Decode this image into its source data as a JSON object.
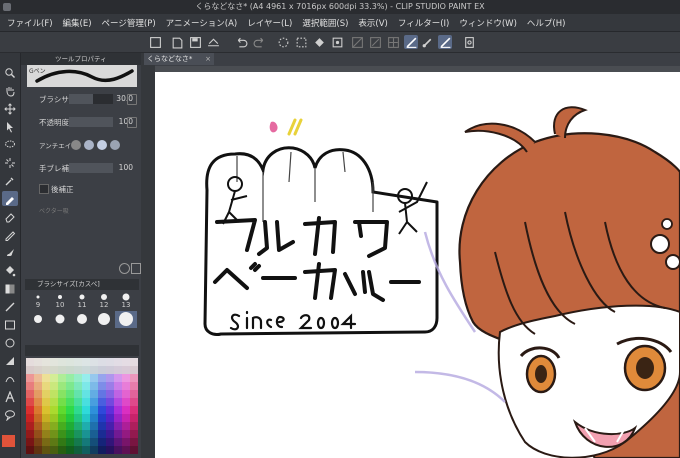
{
  "window": {
    "title": "くらなどなさ*  (A4 4961 x 7016px 600dpi 33.3%)  - CLIP STUDIO PAINT EX"
  },
  "menu": [
    "ファイル(F)",
    "編集(E)",
    "ページ管理(P)",
    "アニメーション(A)",
    "レイヤー(L)",
    "選択範囲(S)",
    "表示(V)",
    "フィルター(I)",
    "ウィンドウ(W)",
    "ヘルプ(H)"
  ],
  "commandbar_icons": [
    "new-icon",
    "open-icon",
    "save-icon",
    "export-icon",
    "undo-icon",
    "redo-icon",
    "deselect-icon",
    "clear-icon",
    "fill-icon",
    "transform-icon",
    "snap-ruler-icon",
    "snap-special-icon",
    "snap-grid-icon",
    "pen-settings-icon",
    "brush-settings-icon",
    "ruler-icon",
    "tablet-icon"
  ],
  "document_tab": {
    "label": "くらなどなさ*",
    "close": "×"
  },
  "subtool": {
    "tab_label": "ツールプロパティ",
    "preview_label": "Gペン",
    "properties": [
      {
        "name": "ブラシサイズ",
        "value": "30.0",
        "fill": 0.55
      },
      {
        "name": "不透明度",
        "value": "100",
        "fill": 1.0
      },
      {
        "name": "アンチエイリ",
        "value": ""
      },
      {
        "name": "手ブレ補正",
        "value": "100",
        "fill": 1.0
      },
      {
        "name": "後補正",
        "value": ""
      },
      {
        "name": "ベクター吸",
        "value": ""
      }
    ]
  },
  "brush_size_panel": {
    "title": "ブラシサイズ[カスペ]",
    "sizes": [
      "9",
      "10",
      "11",
      "12",
      "13"
    ],
    "selected": "13"
  },
  "colors": {
    "accent": "#5a6a88",
    "canvas_bg": "#ffffff",
    "hair": "#c0653f",
    "eyes": "#e08a3a"
  }
}
